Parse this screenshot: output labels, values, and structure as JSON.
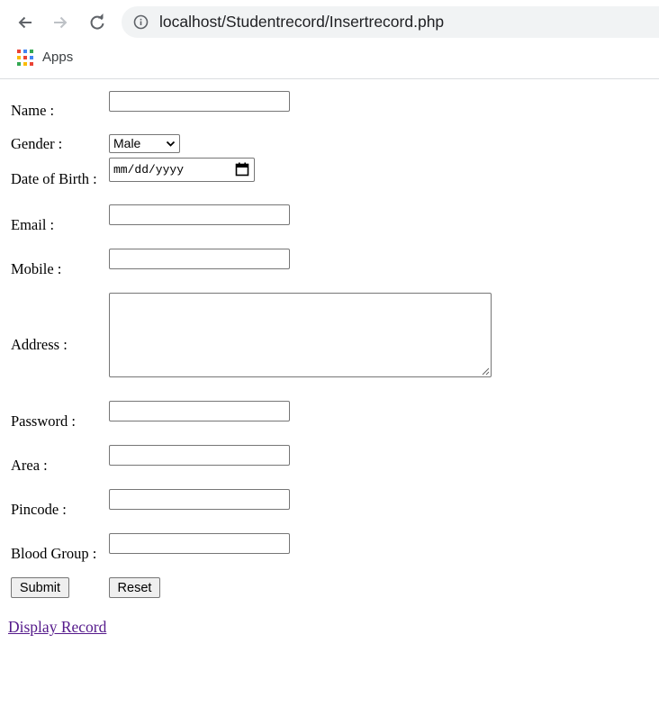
{
  "browser": {
    "url": "localhost/Studentrecord/Insertrecord.php",
    "bookmarks": [
      {
        "label": "Apps"
      }
    ]
  },
  "form": {
    "name_label": "Name :",
    "gender_label": "Gender :",
    "gender_value": "Male",
    "dob_label": "Date of Birth :",
    "dob_placeholder": "mm/dd/yyyy",
    "email_label": "Email :",
    "mobile_label": "Mobile :",
    "address_label": "Address :",
    "password_label": "Password :",
    "area_label": "Area :",
    "pincode_label": "Pincode :",
    "blood_group_label": "Blood Group :",
    "submit_label": "Submit",
    "reset_label": "Reset"
  },
  "links": {
    "display_record": "Display Record"
  },
  "colors": {
    "link_visited": "#551a8b",
    "omnibox_bg": "#f1f3f4",
    "button_bg": "#efefef"
  }
}
